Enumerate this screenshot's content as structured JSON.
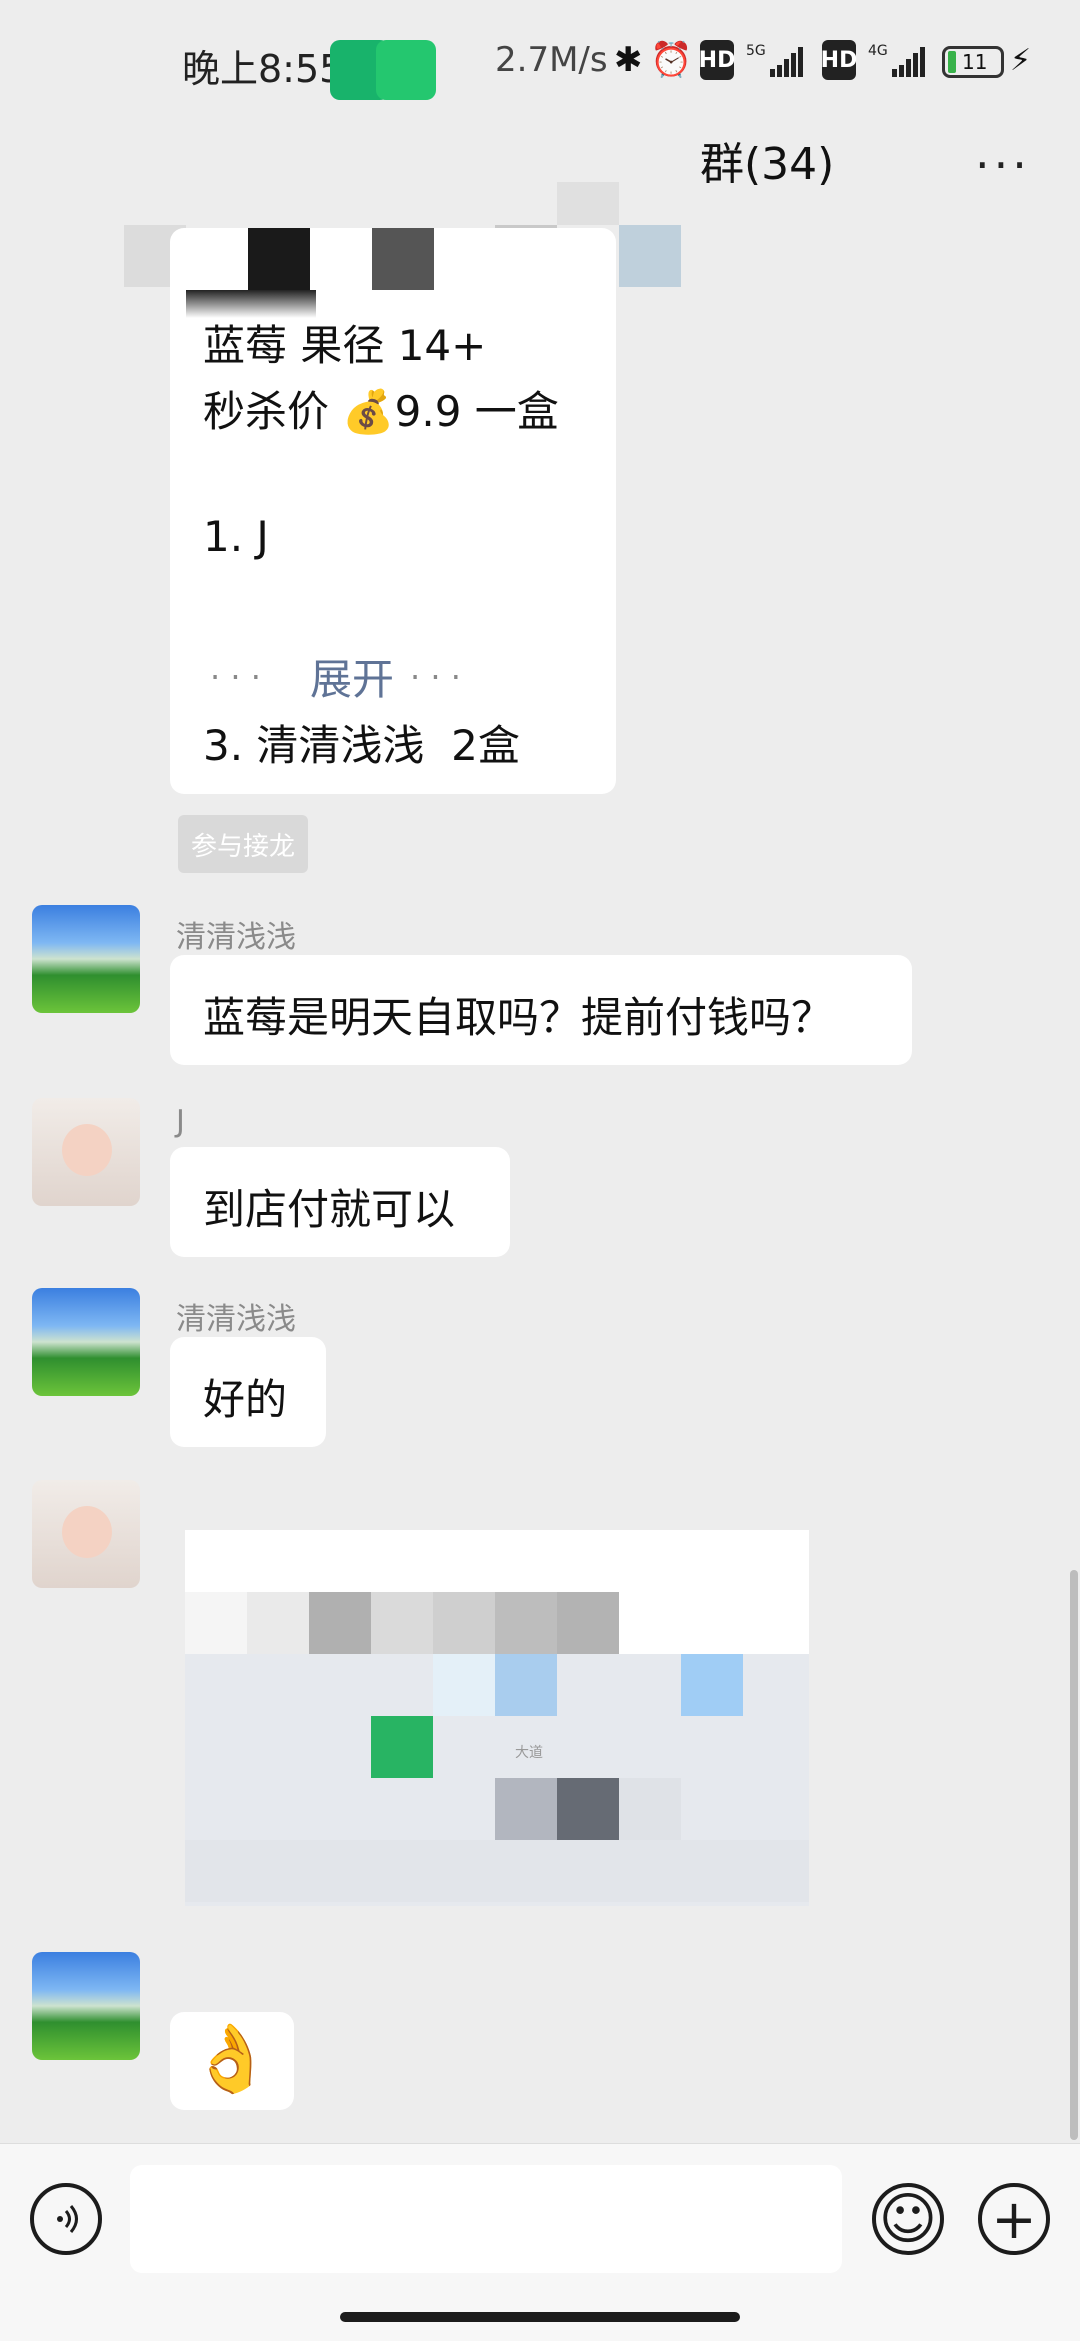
{
  "status_bar": {
    "time": "晚上8:55",
    "speed": "2.7M/s",
    "hd1": "HD",
    "net1": "5G",
    "hd2": "HD",
    "net2": "4G",
    "battery": "11"
  },
  "header": {
    "title": "群(34)",
    "more": "···"
  },
  "messages": {
    "m1_line1": "蓝莓 果径 14+",
    "m1_line2": "秒杀价 💰9.9 一盒",
    "m1_line3": "1. J",
    "m1_expand_dots_left": "· · ·",
    "m1_expand": "展开",
    "m1_expand_dots_right": "· · ·",
    "m1_line4": "3. 清清浅浅  2盒",
    "join_button": "参与接龙",
    "m2_name": "清清浅浅",
    "m2_text": "蓝莓是明天自取吗？提前付钱吗？",
    "m3_name": "J",
    "m3_text": "到店付就可以",
    "m4_name": "清清浅浅",
    "m4_text": "好的",
    "m6_text": "👌"
  },
  "map_card": {
    "road_label": "大道"
  },
  "input_bar": {
    "voice_icon": "voice-icon",
    "emoji_icon": "emoji-icon",
    "plus_icon": "plus-icon",
    "emoji_glyph": "☺",
    "plus_glyph": "+"
  },
  "colors": {
    "background": "#ededed",
    "bubble": "#ffffff",
    "link": "#5f7396",
    "wechat_green": "#18b36b"
  }
}
